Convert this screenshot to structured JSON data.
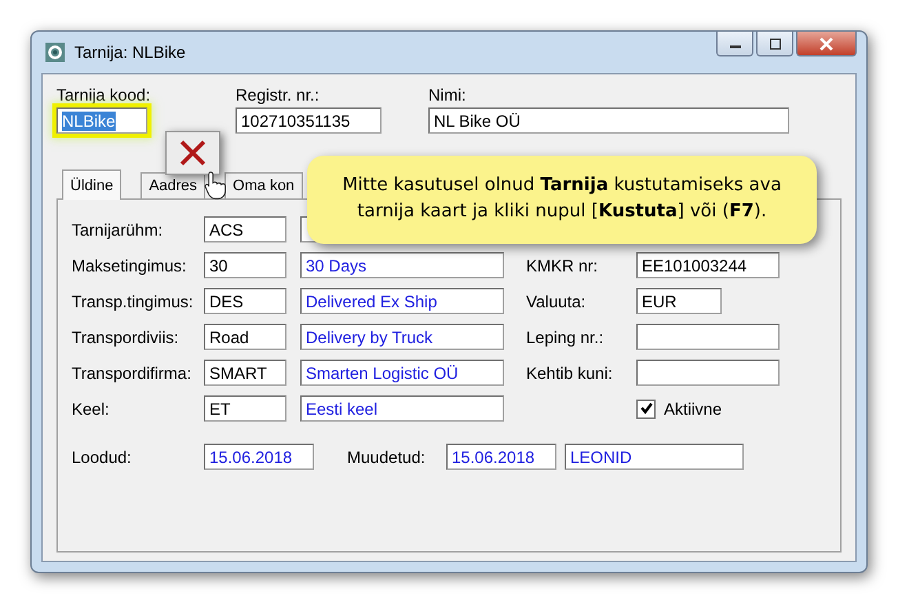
{
  "window": {
    "title": "Tarnija: NLBike"
  },
  "header": [
    {
      "label": "Tarnija kood:",
      "value": "NLBike",
      "highlighted": true
    },
    {
      "label": "Registr. nr.:",
      "value": "102710351135",
      "highlighted": false
    },
    {
      "label": "Nimi:",
      "value": "NL Bike OÜ",
      "highlighted": false
    }
  ],
  "tabs": [
    {
      "label": "Üldine",
      "selected": true
    },
    {
      "label": "Aadres",
      "selected": false
    },
    {
      "label": "Oma kon",
      "selected": false
    }
  ],
  "rows": [
    {
      "label": "Tarnijarühm:",
      "code": "ACS"
    },
    {
      "label": "Maksetingimus:",
      "code": "30",
      "description": "30 Days"
    },
    {
      "label": "Transp.tingimus:",
      "code": "DES",
      "description": "Delivered Ex Ship"
    },
    {
      "label": "Transpordiviis:",
      "code": "Road",
      "description": "Delivery by Truck"
    },
    {
      "label": "Transpordifirma:",
      "code": "SMART",
      "description": "Smarten Logistic OÜ"
    },
    {
      "label": "Keel:",
      "code": "ET",
      "description": "Eesti keel"
    }
  ],
  "right_fields": [
    {
      "label": "KMKR nr:",
      "value": "EE101003244",
      "kind": "wide"
    },
    {
      "label": "Valuuta:",
      "value": "EUR",
      "kind": "narrow"
    },
    {
      "label": "Leping nr.:",
      "kind": "wide"
    },
    {
      "label": "Kehtib kuni:",
      "kind": "wide"
    }
  ],
  "active": {
    "label": "Aktiivne",
    "checked": true
  },
  "created": {
    "label": "Loodud:",
    "date": "15.06.2018"
  },
  "modified": {
    "label": "Muudetud:",
    "date": "15.06.2018",
    "user": "LEONID"
  },
  "callout": {
    "text": "Mitte kasutusel olnud **Tarnija** kustutamiseks ava tarnija kaart ja kliki nupul [**Kustuta**] või (**F7**)."
  }
}
